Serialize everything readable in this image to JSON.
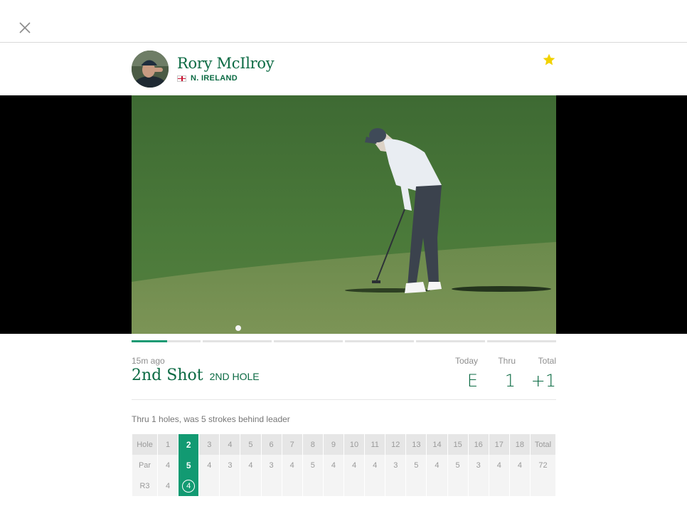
{
  "player": {
    "name": "Rory McIlroy",
    "country": "N. IRELAND",
    "avatar_icon": "player-headshot-icon"
  },
  "icons": {
    "close": "close-icon",
    "favorite": "star-icon",
    "flag": "northern-ireland-flag-icon"
  },
  "colors": {
    "brand_green": "#0b6a43",
    "accent_green": "#129a72",
    "star_yellow": "#f2d200"
  },
  "shot": {
    "time_ago": "15m ago",
    "title": "2nd Shot",
    "hole": "2ND HOLE",
    "summary": "Thru 1 holes, was 5 strokes behind leader"
  },
  "progress": {
    "segments": 6,
    "current_segment": 1,
    "current_fill": 0.52
  },
  "stats": {
    "today_label": "Today",
    "today_value": "E",
    "thru_label": "Thru",
    "thru_value": "1",
    "total_label": "Total",
    "total_value": "+1"
  },
  "scorecard": {
    "hole_label": "Hole",
    "par_label": "Par",
    "round_label": "R3",
    "total_label": "Total",
    "holes": [
      "1",
      "2",
      "3",
      "4",
      "5",
      "6",
      "7",
      "8",
      "9",
      "10",
      "11",
      "12",
      "13",
      "14",
      "15",
      "16",
      "17",
      "18"
    ],
    "par": [
      "4",
      "5",
      "4",
      "3",
      "4",
      "3",
      "4",
      "5",
      "4",
      "4",
      "4",
      "3",
      "5",
      "4",
      "5",
      "3",
      "4",
      "4"
    ],
    "par_total": "72",
    "r3": [
      "4",
      "4",
      "",
      "",
      "",
      "",
      "",
      "",
      "",
      "",
      "",
      "",
      "",
      "",
      "",
      "",
      "",
      "",
      ""
    ],
    "r3_total": "",
    "current_hole_index": 1
  }
}
